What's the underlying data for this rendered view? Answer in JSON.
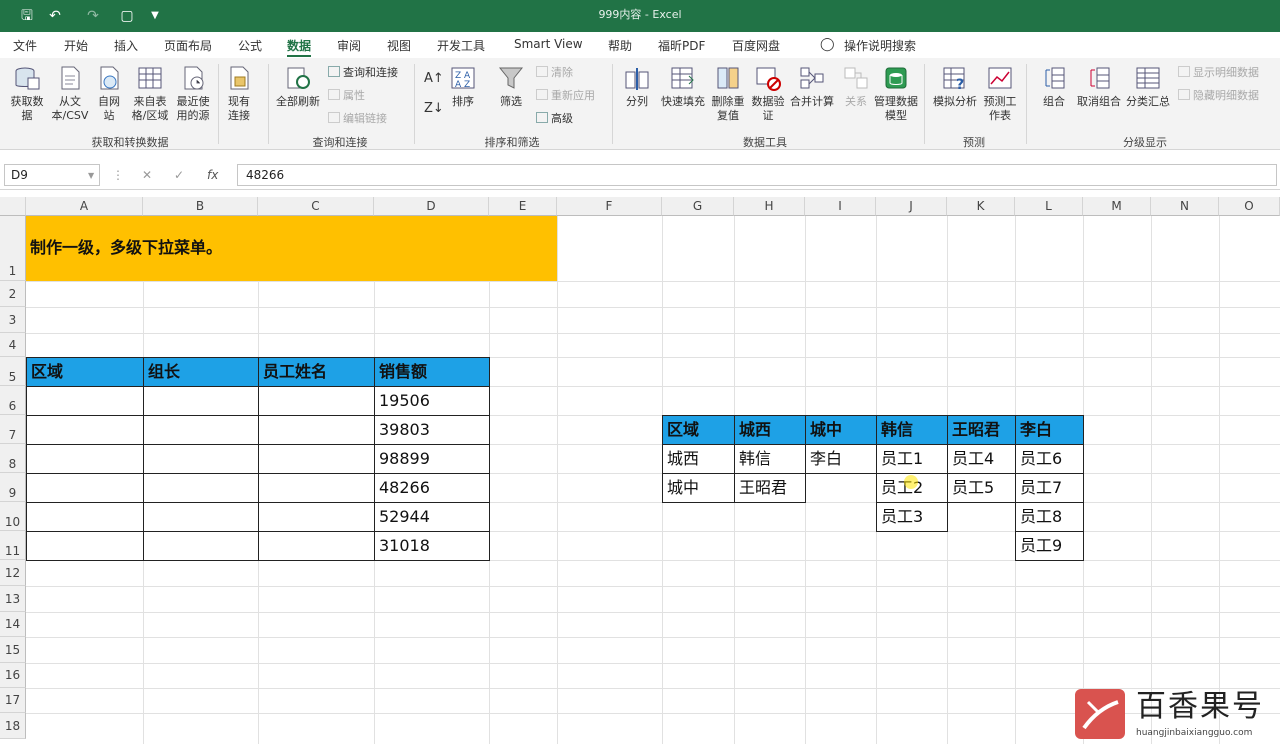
{
  "window": {
    "title": "999内容  -  Excel",
    "accent": "#217346"
  },
  "tabs": [
    "文件",
    "开始",
    "插入",
    "页面布局",
    "公式",
    "数据",
    "审阅",
    "视图",
    "开发工具",
    "Smart View",
    "帮助",
    "福昕PDF",
    "百度网盘",
    "操作说明搜索"
  ],
  "ribbon": {
    "get_data": "获取数据",
    "from_csv": "从文本/CSV",
    "from_web": "自网站",
    "from_table": "来自表格/区域",
    "recent": "最近使用的源",
    "existing": "现有连接",
    "group_get": "获取和转换数据",
    "refresh_all": "全部刷新",
    "queries": "查询和连接",
    "properties": "属性",
    "edit_links": "编辑链接",
    "group_query": "查询和连接",
    "sort": "排序",
    "filter": "筛选",
    "clear": "清除",
    "reapply": "重新应用",
    "advanced": "高级",
    "group_sort": "排序和筛选",
    "split": "分列",
    "flash_fill": "快速填充",
    "remove_dup": "删除重复值",
    "validation": "数据验证",
    "consolidate": "合并计算",
    "relationships": "关系",
    "data_model": "管理数据模型",
    "group_tools": "数据工具",
    "whatif": "模拟分析",
    "forecast": "预测工作表",
    "group_forecast": "预测",
    "group": "组合",
    "ungroup": "取消组合",
    "subtotal": "分类汇总",
    "show_detail": "显示明细数据",
    "hide_detail": "隐藏明细数据",
    "group_outline": "分级显示"
  },
  "formula_bar": {
    "name_box": "D9",
    "fx": "fx",
    "value": "48266"
  },
  "columns": [
    "A",
    "B",
    "C",
    "D",
    "E",
    "F",
    "G",
    "H",
    "I",
    "J",
    "K",
    "L",
    "M",
    "N",
    "O"
  ],
  "rows": [
    "1",
    "2",
    "3",
    "4",
    "5",
    "6",
    "7",
    "8",
    "9",
    "10",
    "11",
    "12",
    "13",
    "14",
    "15",
    "16",
    "17",
    "18"
  ],
  "sheet": {
    "title_cell": "制作一级，多级下拉菜单。",
    "title_fill": "#ffc000",
    "header_fill": "#1ea1e6",
    "table1_headers": [
      "区域",
      "组长",
      "员工姓名",
      "销售额"
    ],
    "table1_sales": [
      "19506",
      "39803",
      "98899",
      "48266",
      "52944",
      "31018"
    ],
    "table2_headers": [
      "区域",
      "城西",
      "城中",
      "韩信",
      "王昭君",
      "李白"
    ],
    "table2_cols": [
      [
        "城西",
        "城中"
      ],
      [
        "韩信",
        "王昭君"
      ],
      [
        "李白"
      ],
      [
        "员工1",
        "员工2",
        "员工3"
      ],
      [
        "员工4",
        "员工5"
      ],
      [
        "员工6",
        "员工7",
        "员工8",
        "员工9"
      ]
    ]
  },
  "watermark": {
    "text": "百香果号",
    "url": "huangjinbaixiangguo.com"
  }
}
